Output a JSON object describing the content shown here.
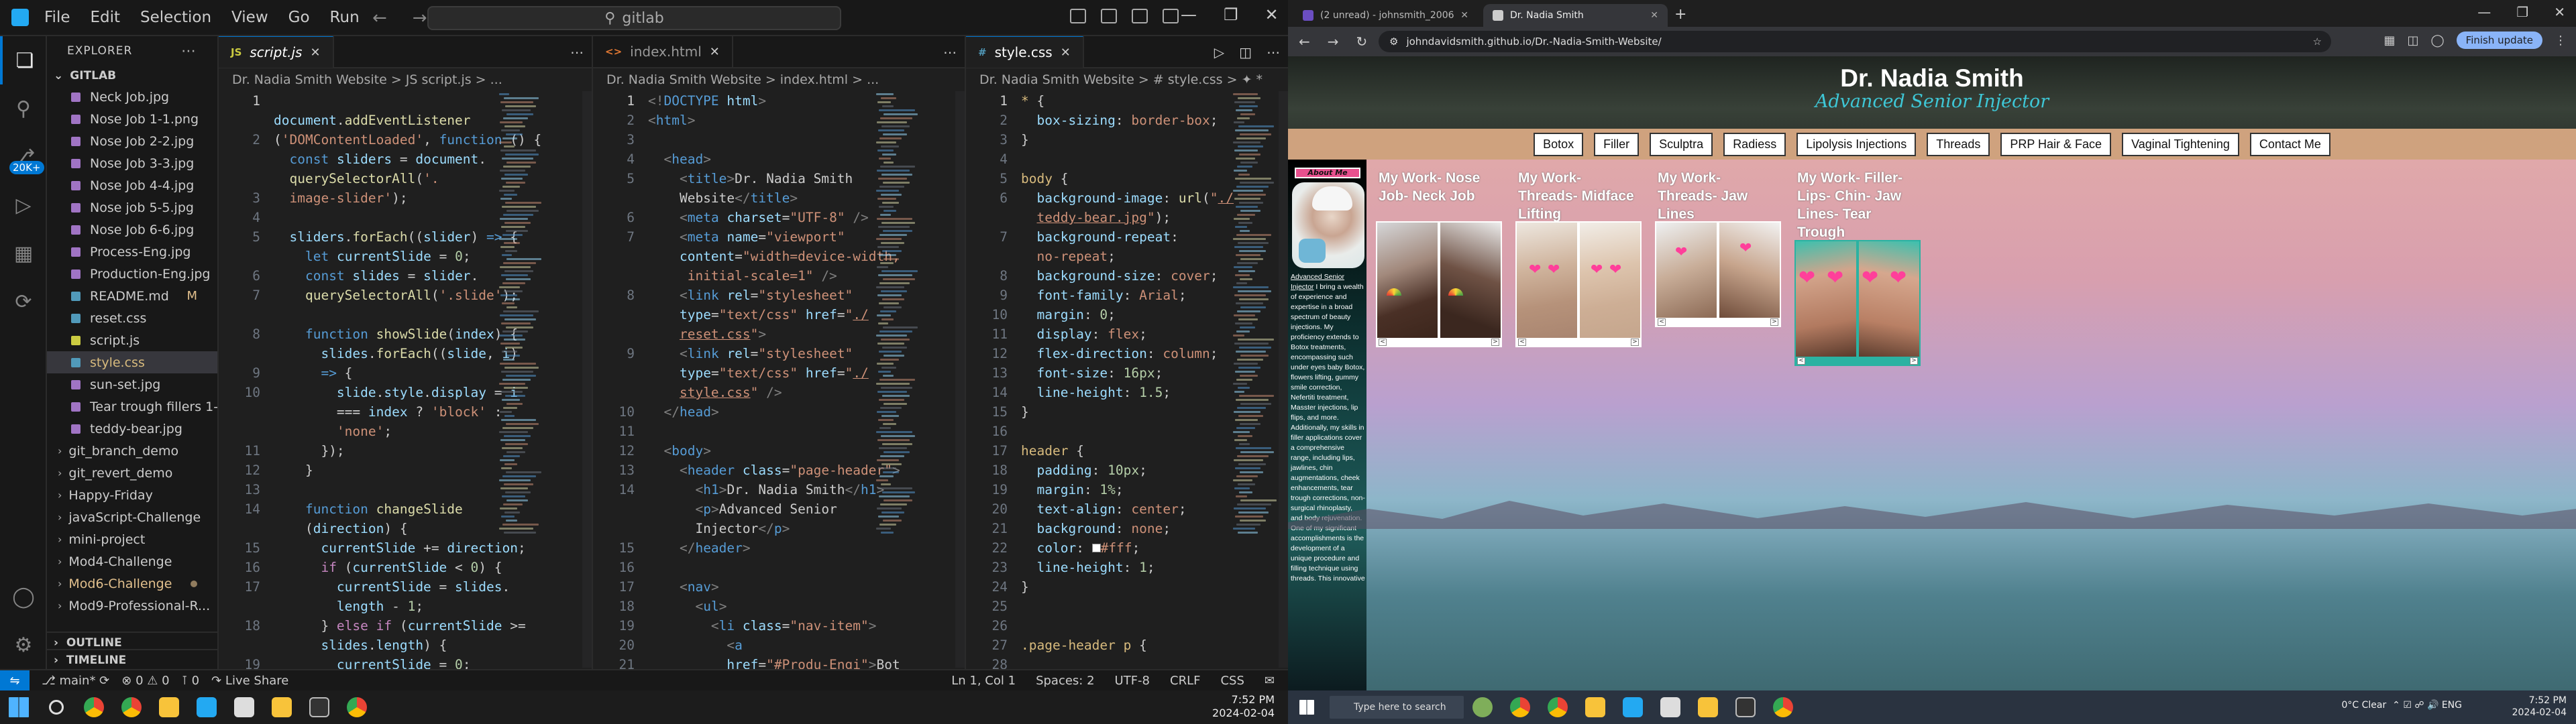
{
  "vscode": {
    "menu": [
      "File",
      "Edit",
      "Selection",
      "View",
      "Go",
      "Run"
    ],
    "search": "gitlab",
    "explorer_title": "EXPLORER",
    "workspace": "GITLAB",
    "files": [
      {
        "name": "Neck Job.jpg",
        "color": "#a074c4"
      },
      {
        "name": "Nose Job 1-1.png",
        "color": "#a074c4"
      },
      {
        "name": "Nose Job 2-2.jpg",
        "color": "#a074c4"
      },
      {
        "name": "Nose Job 3-3.jpg",
        "color": "#a074c4"
      },
      {
        "name": "Nose Job 4-4.jpg",
        "color": "#a074c4"
      },
      {
        "name": "Nose job 5-5.jpg",
        "color": "#a074c4"
      },
      {
        "name": "Nose Job 6-6.jpg",
        "color": "#a074c4"
      },
      {
        "name": "Process-Eng.jpg",
        "color": "#a074c4"
      },
      {
        "name": "Production-Eng.jpg",
        "color": "#a074c4"
      },
      {
        "name": "README.md",
        "color": "#519aba",
        "marker": "M"
      },
      {
        "name": "reset.css",
        "color": "#519aba"
      },
      {
        "name": "script.js",
        "color": "#cbcb41"
      },
      {
        "name": "style.css",
        "color": "#519aba",
        "selected": true
      },
      {
        "name": "sun-set.jpg",
        "color": "#a074c4"
      },
      {
        "name": "Tear trough fillers 1-...",
        "color": "#a074c4"
      },
      {
        "name": "teddy-bear.jpg",
        "color": "#a074c4"
      }
    ],
    "folders": [
      {
        "name": "git_branch_demo"
      },
      {
        "name": "git_revert_demo"
      },
      {
        "name": "Happy-Friday"
      },
      {
        "name": "javaScript-Challenge"
      },
      {
        "name": "mini-project"
      },
      {
        "name": "Mod4-Challenge"
      },
      {
        "name": "Mod6-Challenge",
        "modified": true
      },
      {
        "name": "Mod9-Professional-R..."
      }
    ],
    "outline": "OUTLINE",
    "timeline": "TIMELINE",
    "activity_badge": "20K+",
    "panes": [
      {
        "tab": "script.js",
        "tab_icon": "JS",
        "breadcrumb": "Dr. Nadia Smith Website  >  JS script.js  >  ...",
        "line_numbers": [
          "1",
          "",
          "2",
          "",
          "",
          "3",
          "4",
          "5",
          "",
          "6",
          "7",
          "",
          "8",
          "",
          "9",
          "10",
          "",
          "",
          "11",
          "12",
          "13",
          "14",
          "",
          "15",
          "16",
          "17",
          "",
          "18",
          "",
          "19"
        ]
      },
      {
        "tab": "index.html",
        "tab_icon": "<>",
        "breadcrumb": "Dr. Nadia Smith Website  >  index.html  >  ...",
        "line_numbers": [
          "1",
          "2",
          "3",
          "4",
          "5",
          "",
          "6",
          "7",
          "",
          "",
          "8",
          "",
          "",
          "9",
          "",
          "",
          "10",
          "11",
          "12",
          "13",
          "14",
          "",
          "",
          "15",
          "16",
          "17",
          "18",
          "19",
          "20",
          "21",
          "22"
        ]
      },
      {
        "tab": "style.css",
        "tab_icon": "#",
        "breadcrumb": "Dr. Nadia Smith Website  >  # style.css  >  ✦ *",
        "line_numbers": [
          "1",
          "2",
          "3",
          "4",
          "5",
          "6",
          "",
          "7",
          "",
          "8",
          "9",
          "10",
          "11",
          "12",
          "13",
          "14",
          "15",
          "16",
          "17",
          "18",
          "19",
          "20",
          "21",
          "22",
          "23",
          "24",
          "25",
          "26",
          "27",
          "28"
        ]
      }
    ],
    "status": {
      "branch": "main*",
      "errors": "⊗ 0 ⚠ 0",
      "ports": "0",
      "liveshare": "Live Share",
      "position": "Ln 1, Col 1",
      "spaces": "Spaces: 2",
      "encoding": "UTF-8",
      "eol": "CRLF",
      "lang": "CSS"
    },
    "clock_time": "7:52 PM",
    "clock_date": "2024-02-04"
  },
  "chrome": {
    "tabs": [
      {
        "label": "(2 unread) - johnsmith_2006@...",
        "active": false,
        "color": "#6b4ec2"
      },
      {
        "label": "Dr. Nadia Smith",
        "active": true,
        "color": "#cccccc"
      }
    ],
    "url": "johndavidsmith.github.io/Dr.-Nadia-Smith-Website/",
    "finish_update": "Finish update"
  },
  "site": {
    "title": "Dr. Nadia Smith",
    "subtitle": "Advanced Senior Injector",
    "nav": [
      "Botox",
      "Filler",
      "Sculptra",
      "Radiess",
      "Lipolysis Injections",
      "Threads",
      "PRP Hair & Face",
      "Vaginal Tightening",
      "Contact Me"
    ],
    "about_label": "About Me",
    "about_link": "Advanced Senior Injector",
    "about_text": " I bring a wealth of experience and expertise in a broad spectrum of beauty injections. My proficiency extends to Botox treatments, encompassing such under eyes baby Botox, flowers lifting, gummy smile correction, Nefertiti treatment, Masster injections, lip flips, and more. Additionally, my skills in filler applications cover a comprehensive range, including lips, jawlines, chin augmentations, cheek enhancements, tear trough corrections, non-surgical rhinoplasty, and body rejuvenation. One of my significant accomplishments is the development of a unique procedure and filling technique using threads. This innovative",
    "works": [
      {
        "title": "My Work- Nose Job- Neck Job"
      },
      {
        "title": "My Work- Threads- Midface Lifting"
      },
      {
        "title": "My Work- Threads- Jaw Lines"
      },
      {
        "title": "My Work- Filler- Lips- Chin- Jaw Lines- Tear Trough"
      }
    ],
    "prev": "<",
    "next": ">"
  },
  "taskbar": {
    "search_placeholder": "Type here to search",
    "weather": "0°C  Clear",
    "lang": "ENG",
    "time": "7:52 PM",
    "date": "2024-02-04"
  }
}
